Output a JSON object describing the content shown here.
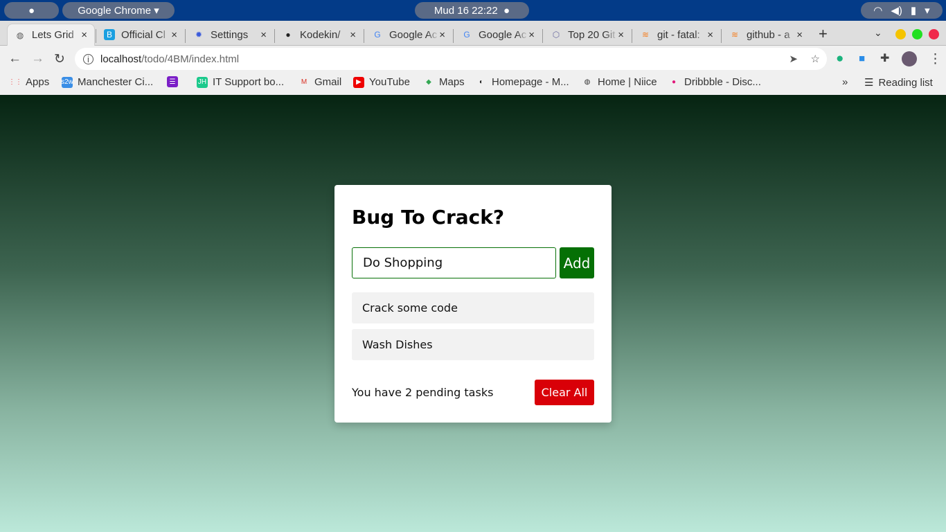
{
  "os": {
    "app_menu": "Google Chrome",
    "clock": "Mud 16  22:22"
  },
  "tabs": [
    {
      "title": "Lets Grid",
      "icon": "globe-icon",
      "active": true
    },
    {
      "title": "Official Cl",
      "icon": "bootstrap-icon"
    },
    {
      "title": "Settings",
      "icon": "gear-icon"
    },
    {
      "title": "Kodekin/",
      "icon": "github-icon"
    },
    {
      "title": "Google Ac",
      "icon": "google-icon"
    },
    {
      "title": "Google Ac",
      "icon": "google-icon"
    },
    {
      "title": "Top 20 Git",
      "icon": "hex-icon"
    },
    {
      "title": "git - fatal:",
      "icon": "stackoverflow-icon"
    },
    {
      "title": "github - a",
      "icon": "stackoverflow-icon"
    }
  ],
  "address": {
    "host": "localhost",
    "path": "/todo/4BM/index.html"
  },
  "bookmarks": [
    "Apps",
    "Manchester Ci...",
    "",
    "IT Support bo...",
    "Gmail",
    "YouTube",
    "Maps",
    "Homepage - M...",
    "Home | Niice",
    "Dribbble - Disc..."
  ],
  "reading_list": "Reading list",
  "todo": {
    "title": "Bug To Crack?",
    "input_value": "Do Shopping",
    "add_label": "Add",
    "items": [
      "Crack some code",
      "Wash Dishes"
    ],
    "pending": "You have 2 pending tasks",
    "clear_label": "Clear All",
    "colors": {
      "accent": "#057005",
      "danger": "#d90008"
    }
  }
}
